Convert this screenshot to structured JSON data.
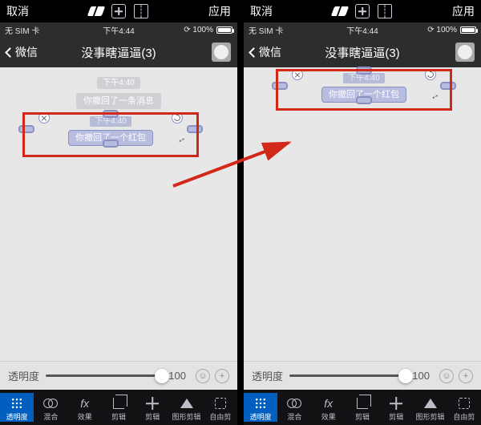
{
  "topbar": {
    "cancel": "取消",
    "apply": "应用"
  },
  "status": {
    "sim": "无 SIM 卡",
    "time": "下午4:44",
    "battery": "100%"
  },
  "chat": {
    "back_label": "微信",
    "title": "没事瞎逼逼(3)",
    "timestamp": "下午4:40",
    "recall_msg": "你撤回了一条消息",
    "recall_redpacket": "你撤回了一个红包"
  },
  "slider": {
    "label": "透明度",
    "value": "100"
  },
  "toolbar": {
    "items": [
      {
        "label": "透明度"
      },
      {
        "label": "混合"
      },
      {
        "label": "效果",
        "fx": "fx"
      },
      {
        "label": "剪辑"
      },
      {
        "label": "剪辑"
      },
      {
        "label": "图形剪辑"
      },
      {
        "label": "自由剪"
      }
    ]
  }
}
